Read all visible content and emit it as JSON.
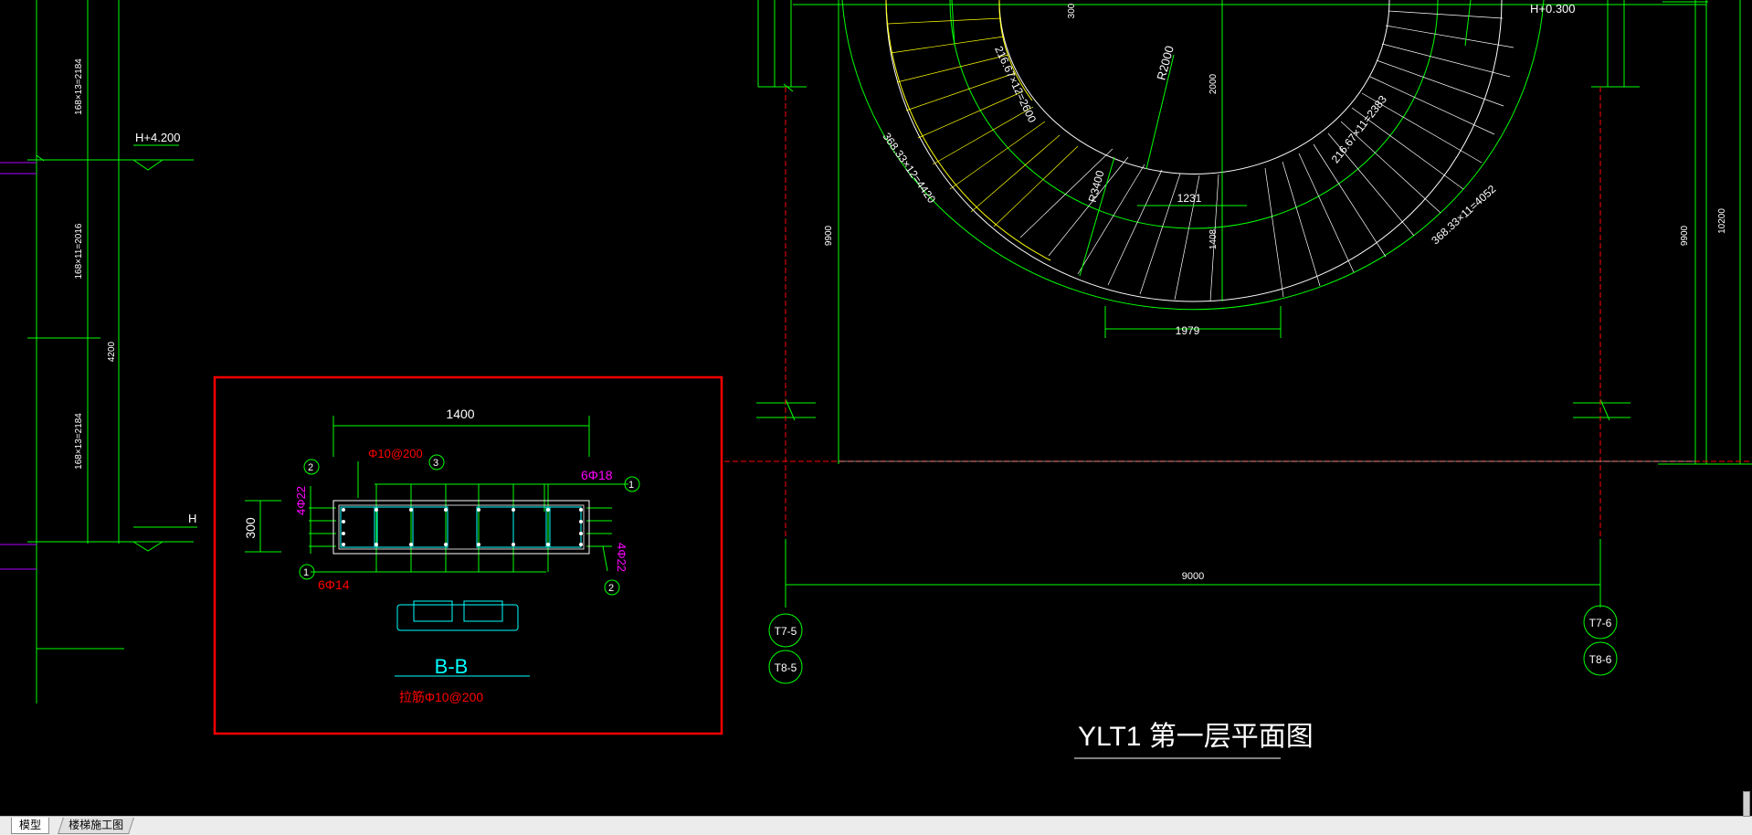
{
  "drawing": {
    "title": "YLT1 第一层平面图",
    "section": {
      "name": "B-B",
      "note": "拉筋Φ10@200",
      "width_dim": "1400",
      "height_dim": "300",
      "stirrup": "Φ10@200",
      "bar_top": "6Φ18",
      "bar_bottom": "6Φ14",
      "bar_left": "4Φ22",
      "bar_right": "4Φ22",
      "mark_1": "1",
      "mark_2": "2",
      "mark_3": "3"
    },
    "elevation": {
      "level_top": "H+4.200",
      "level_bottom": "H",
      "flight_top": "168×13=2184",
      "flight_mid": "168×11=2016",
      "flight_bottom": "168×13=2184",
      "total_height": "4200"
    },
    "plan": {
      "level": "H+0.300",
      "top_small": "300",
      "radius": "R2000",
      "dim_2000": "2000",
      "dim_1408": "1408",
      "dim_1231": "1231",
      "dim_1979": "1979",
      "dim_9000": "9000",
      "dim_9900_left": "9900",
      "dim_9900_right": "9900",
      "dim_10200": "10200",
      "inner_left": "216.67×12=2600",
      "inner_right": "216.67×11=2383",
      "outer_left": "368.33×12=4420",
      "outer_right": "368.33×11=4052",
      "r_mid": "R3400",
      "axis_t7_5": "T7-5",
      "axis_t8_5": "T8-5",
      "axis_t7_6": "T7-6",
      "axis_t8_6": "T8-6"
    }
  },
  "tabs": {
    "model": "模型",
    "layout": "楼梯施工图"
  },
  "colors": {
    "background": "#000000",
    "green": "#00ff00",
    "yellow": "#ffff00",
    "white": "#ffffff",
    "red": "#ff0000",
    "magenta": "#ff00ff",
    "cyan": "#00ffff",
    "purple": "#b000ff"
  }
}
